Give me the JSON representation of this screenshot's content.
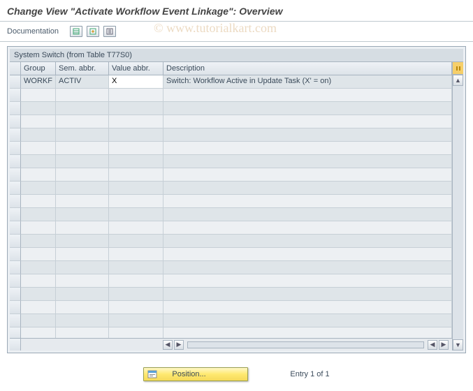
{
  "title": "Change View \"Activate Workflow Event Linkage\": Overview",
  "toolbar": {
    "doc_label": "Documentation"
  },
  "panel": {
    "header": "System Switch (from Table T77S0)"
  },
  "columns": {
    "group": "Group",
    "sem": "Sem. abbr.",
    "val": "Value abbr.",
    "desc": "Description"
  },
  "rows": [
    {
      "group": "WORKF",
      "sem": "ACTIV",
      "val": "X",
      "desc": "Switch: Workflow Active in Update Task (X' = on)"
    }
  ],
  "footer": {
    "position_label": "Position...",
    "entry_text": "Entry 1 of 1"
  },
  "watermark": "© www.tutorialkart.com"
}
